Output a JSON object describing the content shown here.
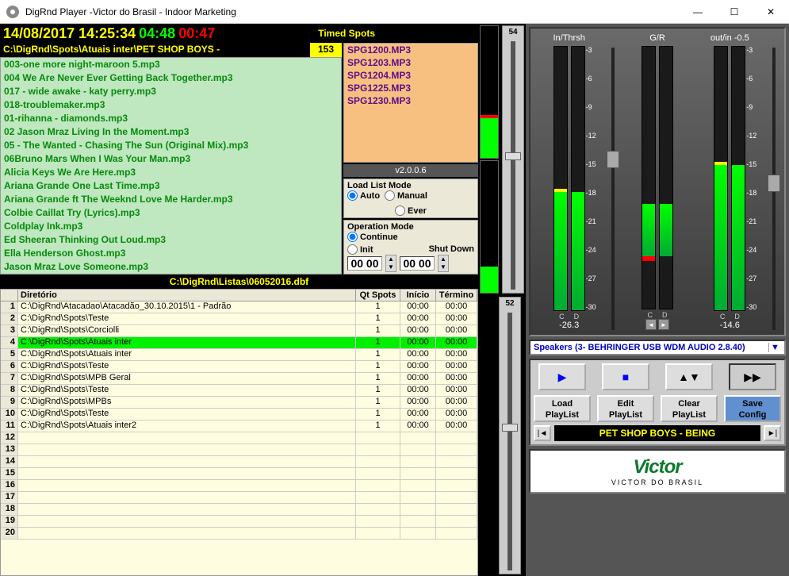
{
  "window": {
    "title": "DigRnd Player -Victor do Brasil - Indoor Marketing"
  },
  "clock": {
    "datetime": "14/08/2017  14:25:34",
    "total": "04:48",
    "elapsed": "00:47"
  },
  "timed_spots_label": "Timed Spots",
  "current_path": "C:\\DigRnd\\Spots\\Atuais inter\\PET SHOP BOYS -",
  "current_count": "153",
  "songs": [
    "003-one more night-maroon 5.mp3",
    "004 We Are Never Ever Getting Back Together.mp3",
    "017 - wide awake - katy perry.mp3",
    "018-troublemaker.mp3",
    "01-rihanna - diamonds.mp3",
    "02 Jason Mraz Living In the Moment.mp3",
    "05 - The Wanted - Chasing The Sun (Original Mix).mp3",
    "06Bruno Mars When I Was Your Man.mp3",
    "Alicia Keys   We Are Here.mp3",
    "Ariana Grande   One Last Time.mp3",
    "Ariana Grande ft The Weeknd Love Me Harder.mp3",
    "Colbie Caillat   Try (Lyrics).mp3",
    "Coldplay Ink.mp3",
    "Ed Sheeran  Thinking Out Loud.mp3",
    "Ella Henderson   Ghost.mp3",
    "Jason Mraz   Love Someone.mp3"
  ],
  "spots": [
    "SPG1200.MP3",
    "SPG1203.MP3",
    "SPG1204.MP3",
    "SPG1225.MP3",
    "SPG1230.MP3"
  ],
  "version": "v2.0.0.6",
  "load_mode": {
    "label": "Load List Mode",
    "auto": "Auto",
    "manual": "Manual",
    "ever": "Ever"
  },
  "op_mode": {
    "label": "Operation Mode",
    "cont": "Continue",
    "init": "Init",
    "shut": "Shut Down",
    "t1": "00 00",
    "t2": "00 00"
  },
  "list_path": "C:\\DigRnd\\Listas\\06052016.dbf",
  "cols": {
    "dir": "Diretório",
    "qt": "Qt Spots",
    "ini": "Início",
    "ter": "Término"
  },
  "rows": [
    {
      "n": "1",
      "d": "C:\\DigRnd\\Atacadao\\Atacadão_30.10.2015\\1 - Padrão",
      "q": "1",
      "i": "00:00",
      "t": "00:00"
    },
    {
      "n": "2",
      "d": "C:\\DigRnd\\Spots\\Teste",
      "q": "1",
      "i": "00:00",
      "t": "00:00"
    },
    {
      "n": "3",
      "d": "C:\\DigRnd\\Spots\\Corciolli",
      "q": "1",
      "i": "00:00",
      "t": "00:00"
    },
    {
      "n": "4",
      "d": "C:\\DigRnd\\Spots\\Atuais inter",
      "q": "1",
      "i": "00:00",
      "t": "00:00",
      "sel": true
    },
    {
      "n": "5",
      "d": "C:\\DigRnd\\Spots\\Atuais inter",
      "q": "1",
      "i": "00:00",
      "t": "00:00"
    },
    {
      "n": "6",
      "d": "C:\\DigRnd\\Spots\\Teste",
      "q": "1",
      "i": "00:00",
      "t": "00:00"
    },
    {
      "n": "7",
      "d": "C:\\DigRnd\\Spots\\MPB Geral",
      "q": "1",
      "i": "00:00",
      "t": "00:00"
    },
    {
      "n": "8",
      "d": "C:\\DigRnd\\Spots\\Teste",
      "q": "1",
      "i": "00:00",
      "t": "00:00"
    },
    {
      "n": "9",
      "d": "C:\\DigRnd\\Spots\\MPBs",
      "q": "1",
      "i": "00:00",
      "t": "00:00"
    },
    {
      "n": "10",
      "d": "C:\\DigRnd\\Spots\\Teste",
      "q": "1",
      "i": "00:00",
      "t": "00:00"
    },
    {
      "n": "11",
      "d": "C:\\DigRnd\\Spots\\Atuais inter2",
      "q": "1",
      "i": "00:00",
      "t": "00:00"
    },
    {
      "n": "12"
    },
    {
      "n": "13"
    },
    {
      "n": "14"
    },
    {
      "n": "15"
    },
    {
      "n": "16"
    },
    {
      "n": "17"
    },
    {
      "n": "18"
    },
    {
      "n": "19"
    },
    {
      "n": "20"
    }
  ],
  "vsl1": "54",
  "vsl2": "52",
  "meters": {
    "in_label": "In/Thrsh",
    "gr_label": "G/R",
    "out_label": "out/in  -0.5",
    "ticks": [
      "-3",
      "-6",
      "-9",
      "-12",
      "-15",
      "-18",
      "-21",
      "-24",
      "-27",
      "-30"
    ],
    "val1": "-26.3",
    "val2": "-14.6",
    "cd": "C",
    "dd": "D"
  },
  "device": "Speakers (3- BEHRINGER USB WDM AUDIO 2.8.40)",
  "btns": {
    "load": "Load\nPlayList",
    "edit": "Edit\nPlayList",
    "clear": "Clear\nPlayList",
    "save": "Save\nConfig"
  },
  "now_playing": "PET SHOP BOYS - BEING",
  "logo1": "Victor",
  "logo2": "VICTOR DO BRASIL"
}
